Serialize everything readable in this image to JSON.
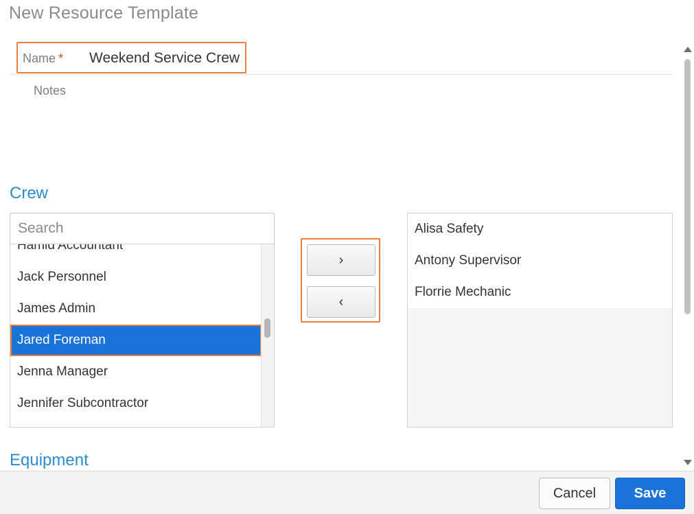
{
  "dialog": {
    "title": "New Resource Template"
  },
  "form": {
    "name_label": "Name",
    "required_marker": "*",
    "name_value": "Weekend Service Crew",
    "notes_label": "Notes"
  },
  "crew": {
    "heading": "Crew",
    "search_placeholder": "Search",
    "available": [
      {
        "label": "Hamid Accountant",
        "selected": false
      },
      {
        "label": "Jack Personnel",
        "selected": false
      },
      {
        "label": "James Admin",
        "selected": false
      },
      {
        "label": "Jared Foreman",
        "selected": true
      },
      {
        "label": "Jenna Manager",
        "selected": false
      },
      {
        "label": "Jennifer Subcontractor",
        "selected": false
      }
    ],
    "add_icon": "chevron-right-icon",
    "remove_icon": "chevron-left-icon",
    "add_glyph": "›",
    "remove_glyph": "‹",
    "assigned": [
      {
        "label": "Alisa Safety"
      },
      {
        "label": "Antony Supervisor"
      },
      {
        "label": "Florrie Mechanic"
      }
    ]
  },
  "equipment": {
    "heading": "Equipment"
  },
  "footer": {
    "cancel_label": "Cancel",
    "save_label": "Save"
  },
  "colors": {
    "accent": "#2e8bd3",
    "primary_button": "#1a73d9",
    "highlight_outline": "#ee7f3b",
    "required": "#d93a3a"
  }
}
